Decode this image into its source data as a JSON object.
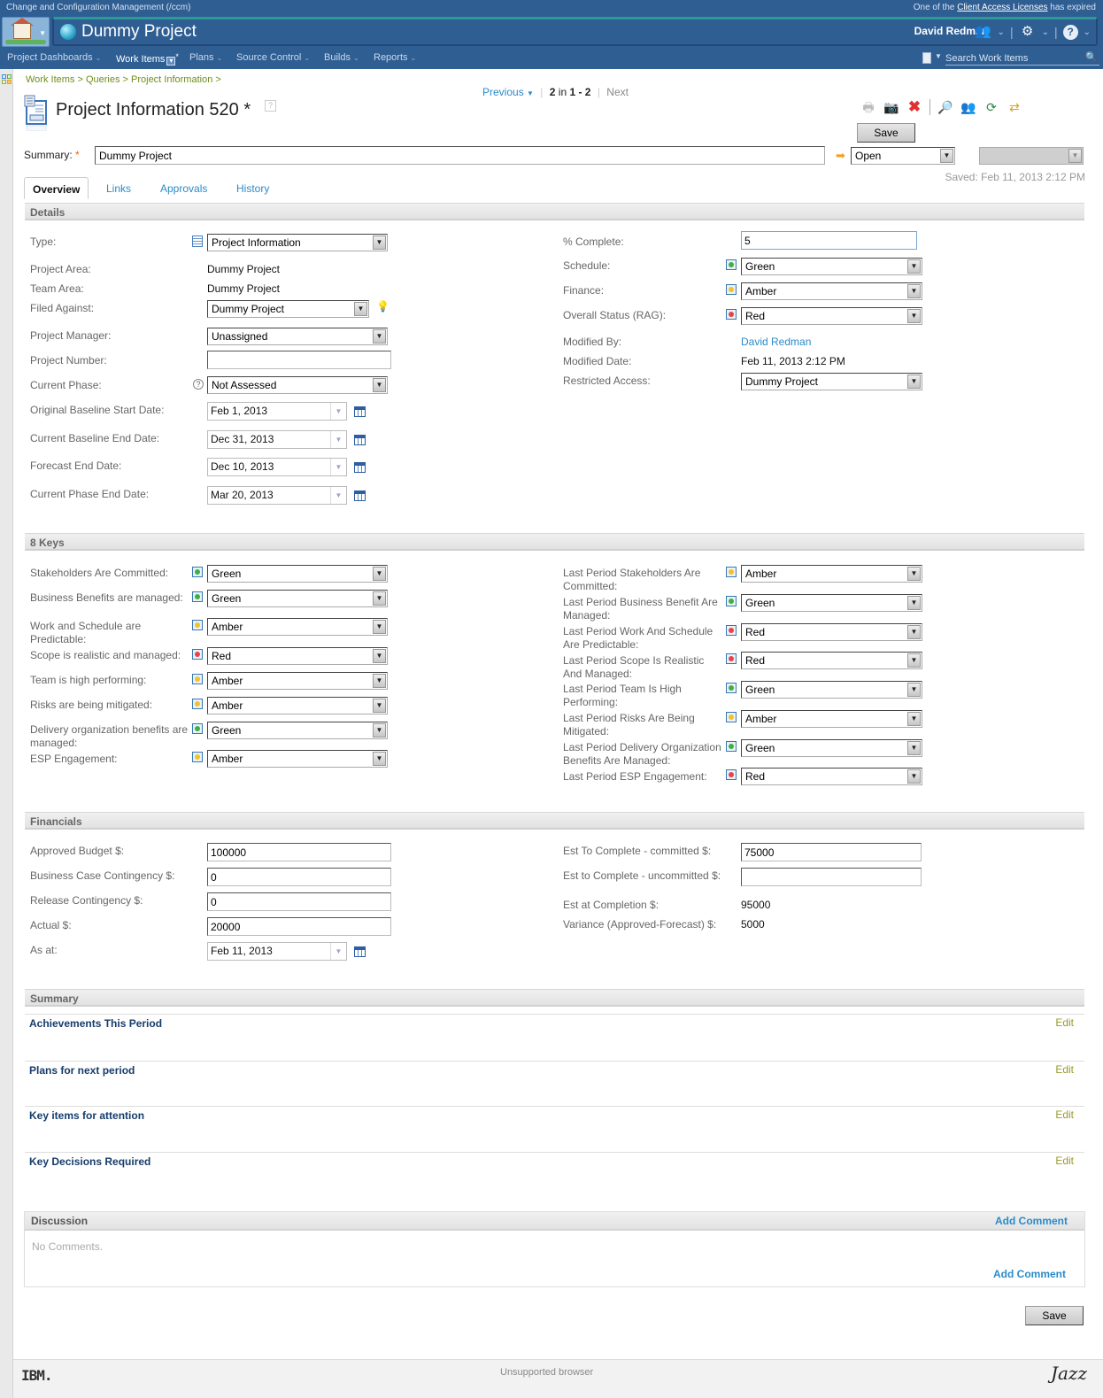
{
  "topbar": {
    "app_name": "Change and Configuration Management (/ccm)",
    "license_prefix": "One of the ",
    "license_link": "Client Access Licenses",
    "license_suffix": " has expired"
  },
  "banner": {
    "project": "Dummy Project",
    "user": "David Redman",
    "icons": [
      "home-icon",
      "globe-icon",
      "users-icon",
      "gear-icon",
      "help-icon"
    ]
  },
  "nav": {
    "items": [
      {
        "label": "Project Dashboards"
      },
      {
        "label": "Work Items",
        "marker": "*"
      },
      {
        "label": "Plans"
      },
      {
        "label": "Source Control"
      },
      {
        "label": "Builds"
      },
      {
        "label": "Reports"
      }
    ],
    "search_placeholder": "Search Work Items"
  },
  "breadcrumb": "Work Items > Queries > Project Information >",
  "pager": {
    "previous": "Previous",
    "position": "2",
    "in": " in ",
    "range": "1 - 2",
    "next": "Next"
  },
  "workitem": {
    "title": "Project Information 520 *",
    "save_label": "Save",
    "summary_label": "Summary:",
    "required_mark": "*",
    "summary_value": "Dummy Project",
    "state": "Open",
    "resolution": "",
    "saved": "Saved: Feb 11, 2013 2:12 PM",
    "toolbar_icons": [
      "print-icon",
      "snapshot-icon",
      "delete-icon",
      "find-related-icon",
      "subscribers-icon",
      "refresh-icon",
      "link-icon"
    ]
  },
  "tabs": [
    {
      "label": "Overview",
      "active": true
    },
    {
      "label": "Links"
    },
    {
      "label": "Approvals"
    },
    {
      "label": "History"
    }
  ],
  "details": {
    "header": "Details",
    "left": {
      "type_label": "Type:",
      "type_value": "Project Information",
      "project_area_label": "Project Area:",
      "project_area_value": "Dummy Project",
      "team_area_label": "Team Area:",
      "team_area_value": "Dummy Project",
      "filed_against_label": "Filed Against:",
      "filed_against_value": "Dummy Project",
      "pm_label": "Project Manager:",
      "pm_value": "Unassigned",
      "number_label": "Project Number:",
      "number_value": "",
      "phase_label": "Current Phase:",
      "phase_value": "Not Assessed",
      "obsd_label": "Original Baseline Start Date:",
      "obsd_value": "Feb 1, 2013",
      "cbed_label": "Current Baseline End Date:",
      "cbed_value": "Dec 31, 2013",
      "fed_label": "Forecast End Date:",
      "fed_value": "Dec 10, 2013",
      "cped_label": "Current Phase End Date:",
      "cped_value": "Mar 20, 2013"
    },
    "right": {
      "complete_label": "% Complete:",
      "complete_value": "5",
      "schedule_label": "Schedule:",
      "schedule_value": "Green",
      "finance_label": "Finance:",
      "finance_value": "Amber",
      "overall_label": "Overall Status (RAG):",
      "overall_value": "Red",
      "modified_by_label": "Modified By:",
      "modified_by_value": "David Redman",
      "modified_date_label": "Modified Date:",
      "modified_date_value": "Feb 11, 2013 2:12 PM",
      "restricted_label": "Restricted Access:",
      "restricted_value": "Dummy Project"
    }
  },
  "keys": {
    "header": "8 Keys",
    "left": [
      {
        "label": "Stakeholders Are Committed:",
        "value": "Green"
      },
      {
        "label": "Business Benefits are managed:",
        "value": "Green"
      },
      {
        "label": "Work and Schedule are Predictable:",
        "value": "Amber"
      },
      {
        "label": "Scope is realistic and managed:",
        "value": "Red"
      },
      {
        "label": "Team is high performing:",
        "value": "Amber"
      },
      {
        "label": "Risks are being mitigated:",
        "value": "Amber"
      },
      {
        "label": "Delivery organization benefits are managed:",
        "value": "Green"
      },
      {
        "label": "ESP Engagement:",
        "value": "Amber"
      }
    ],
    "right": [
      {
        "label": "Last Period Stakeholders Are Committed:",
        "value": "Amber"
      },
      {
        "label": "Last Period Business Benefit Are Managed:",
        "value": "Green"
      },
      {
        "label": "Last Period Work And Schedule Are Predictable:",
        "value": "Red"
      },
      {
        "label": "Last Period Scope Is Realistic And Managed:",
        "value": "Red"
      },
      {
        "label": "Last Period Team Is High Performing:",
        "value": "Green"
      },
      {
        "label": "Last Period Risks Are Being Mitigated:",
        "value": "Amber"
      },
      {
        "label": "Last Period Delivery Organization Benefits Are Managed:",
        "value": "Green"
      },
      {
        "label": "Last Period ESP Engagement:",
        "value": "Red"
      }
    ]
  },
  "rag_colors": {
    "Green": "#3cb043",
    "Amber": "#f2c12e",
    "Red": "#e8424a"
  },
  "financials": {
    "header": "Financials",
    "approved_label": "Approved Budget $:",
    "approved_value": "100000",
    "bcc_label": "Business Case Contingency $:",
    "bcc_value": "0",
    "rc_label": "Release Contingency $:",
    "rc_value": "0",
    "actual_label": "Actual $:",
    "actual_value": "20000",
    "asat_label": "As at:",
    "asat_value": "Feb 11, 2013",
    "etc_c_label": "Est To Complete - committed $:",
    "etc_c_value": "75000",
    "etc_u_label": "Est to Complete - uncommitted $:",
    "etc_u_value": "",
    "eac_label": "Est at Completion $:",
    "eac_value": "95000",
    "variance_label": "Variance (Approved-Forecast) $:",
    "variance_value": "5000"
  },
  "summary": {
    "header": "Summary",
    "edit_label": "Edit",
    "items": [
      {
        "title": "Achievements This Period"
      },
      {
        "title": "Plans for next period"
      },
      {
        "title": "Key items for attention"
      },
      {
        "title": "Key Decisions Required"
      }
    ]
  },
  "discussion": {
    "header": "Discussion",
    "add_comment": "Add Comment",
    "empty": "No Comments."
  },
  "footer": {
    "ibm": "IBM.",
    "status": "Unsupported browser",
    "jazz": "Jazz"
  }
}
